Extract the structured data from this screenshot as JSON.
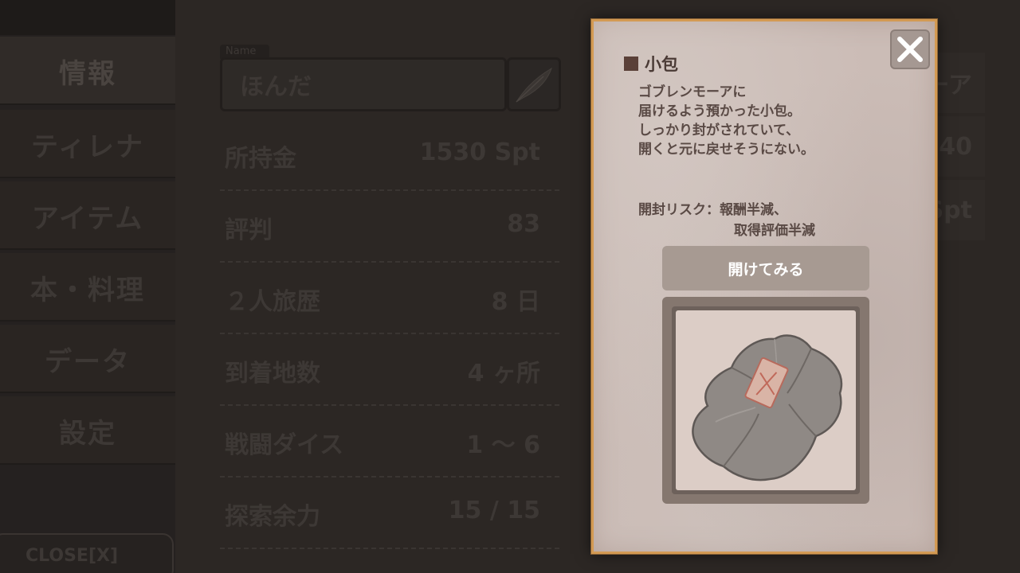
{
  "sidebar": {
    "items": [
      {
        "label": "情報"
      },
      {
        "label": "ティレナ"
      },
      {
        "label": "アイテム"
      },
      {
        "label": "本・料理"
      },
      {
        "label": "データ"
      },
      {
        "label": "設定"
      }
    ],
    "close_label": "CLOSE[X]"
  },
  "profile": {
    "name_tag": "Name",
    "name_value": "ほんだ",
    "stats": [
      {
        "label": "所持金",
        "value": "1530 Spt"
      },
      {
        "label": "評判",
        "value": "83"
      },
      {
        "label": "２人旅歴",
        "value": "8 日"
      },
      {
        "label": "到着地数",
        "value": "4 ヶ所"
      },
      {
        "label": "戦闘ダイス",
        "value": "1 ～ 6"
      },
      {
        "label": "探索余力",
        "value": "15 / 15"
      }
    ]
  },
  "background_panel": {
    "fragments": [
      "ーア",
      "40",
      "Spt"
    ]
  },
  "popup": {
    "title": "小包",
    "description": [
      "ゴブレンモーアに",
      "届けるよう預かった小包。",
      "しっかり封がされていて、",
      "開くと元に戻せそうにない。"
    ],
    "risk_line1": "開封リスク：報酬半減、",
    "risk_line2": "取得評価半減",
    "open_button": "開けてみる",
    "close_icon": "close-icon"
  },
  "colors": {
    "popup_border": "#d39a53",
    "popup_bg": "#cbbcb6",
    "button_bg": "#a79a92"
  }
}
